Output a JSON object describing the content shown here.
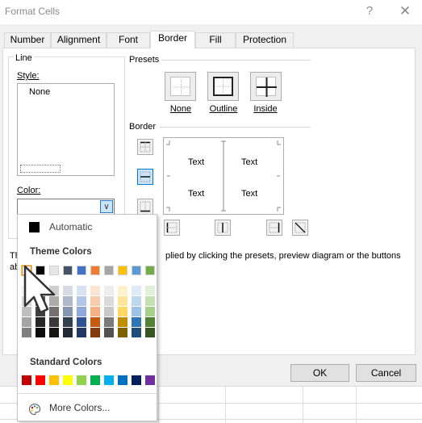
{
  "window": {
    "title": "Format Cells",
    "help_glyph": "?",
    "close_glyph": "✕"
  },
  "tabs": [
    {
      "label": "Number"
    },
    {
      "label": "Alignment"
    },
    {
      "label": "Font"
    },
    {
      "label": "Border",
      "active": true
    },
    {
      "label": "Fill"
    },
    {
      "label": "Protection"
    }
  ],
  "line": {
    "group_label": "Line",
    "style_label": "Style:",
    "style_value": "None",
    "color_label": "Color:"
  },
  "presets": {
    "label": "Presets",
    "items": [
      {
        "label": "None"
      },
      {
        "label": "Outline"
      },
      {
        "label": "Inside"
      }
    ]
  },
  "border": {
    "label": "Border",
    "preview_texts": [
      "Text",
      "Text",
      "Text",
      "Text"
    ]
  },
  "instruction": "The selected border style can be applied by clicking the presets, preview diagram or the buttons above.",
  "instruction_visible_prefix": "Th",
  "instruction_visible_middle": "plied by clicking the presets, preview diagram or the buttons",
  "instruction_visible_line2": "ab",
  "buttons": {
    "ok": "OK",
    "cancel": "Cancel"
  },
  "color_dropdown": {
    "automatic_label": "Automatic",
    "theme_heading": "Theme Colors",
    "standard_heading": "Standard Colors",
    "more_colors": "More Colors...",
    "theme_top": [
      "#FFFFFF",
      "#000000",
      "#E7E6E6",
      "#44546A",
      "#4472C4",
      "#ED7D31",
      "#A5A5A5",
      "#FFC000",
      "#5B9BD5",
      "#70AD47"
    ],
    "theme_shades": [
      [
        "#F2F2F2",
        "#7F7F7F",
        "#D0CECE",
        "#D6DCE4",
        "#D9E2F3",
        "#FBE5D5",
        "#EDEDED",
        "#FFF2CC",
        "#DEEAF6",
        "#E2EFD9"
      ],
      [
        "#D8D8D8",
        "#595959",
        "#AEABAB",
        "#ADB9CA",
        "#B4C6E7",
        "#F7CBAC",
        "#DBDBDB",
        "#FEE599",
        "#BDD7EE",
        "#C5E0B3"
      ],
      [
        "#BFBFBF",
        "#3F3F3F",
        "#757070",
        "#8496B0",
        "#8EAADB",
        "#F4B183",
        "#C9C9C9",
        "#FFD965",
        "#9CC3E5",
        "#A8D08D"
      ],
      [
        "#A5A5A5",
        "#262626",
        "#3A3838",
        "#323F4F",
        "#2F5496",
        "#C55A11",
        "#7B7B7B",
        "#BF8F00",
        "#2E75B5",
        "#538135"
      ],
      [
        "#7F7F7F",
        "#0C0C0C",
        "#171616",
        "#222A35",
        "#1F3864",
        "#833C0B",
        "#525252",
        "#7F6000",
        "#1E4E79",
        "#375623"
      ]
    ],
    "standard": [
      "#C00000",
      "#FF0000",
      "#FFC000",
      "#FFFF00",
      "#92D050",
      "#00B050",
      "#00B0F0",
      "#0070C0",
      "#002060",
      "#7030A0"
    ]
  }
}
